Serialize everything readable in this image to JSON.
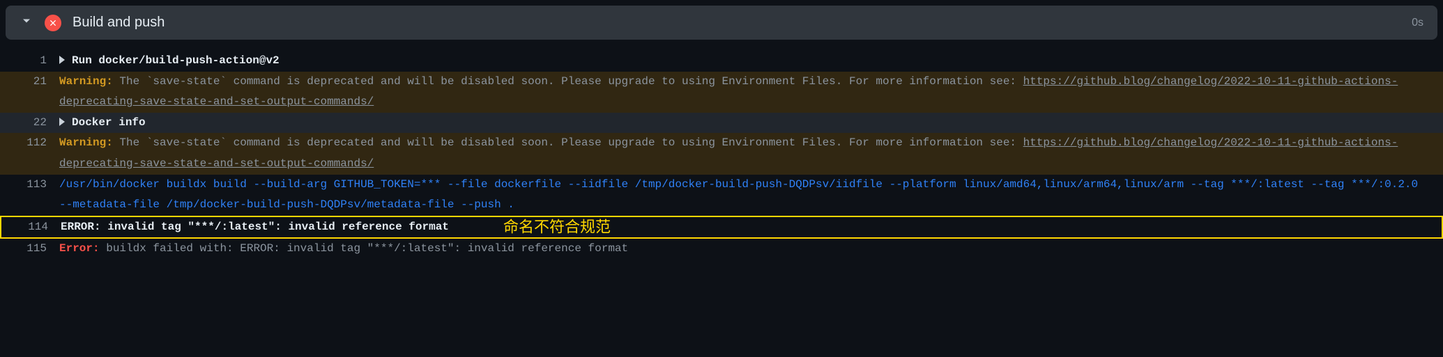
{
  "header": {
    "title": "Build and push",
    "duration": "0s"
  },
  "lines": {
    "l1": {
      "num": "1",
      "content": "Run docker/build-push-action@v2"
    },
    "l21": {
      "num": "21",
      "prefix": "Warning:",
      "text": " The `save-state` command is deprecated and will be disabled soon. Please upgrade to using Environment Files. For more information see: ",
      "link": "https://github.blog/changelog/2022-10-11-github-actions-deprecating-save-state-and-set-output-commands/"
    },
    "l22": {
      "num": "22",
      "content": "Docker info"
    },
    "l112": {
      "num": "112",
      "prefix": "Warning:",
      "text": " The `save-state` command is deprecated and will be disabled soon. Please upgrade to using Environment Files. For more information see: ",
      "link": "https://github.blog/changelog/2022-10-11-github-actions-deprecating-save-state-and-set-output-commands/"
    },
    "l113": {
      "num": "113",
      "content": "/usr/bin/docker buildx build --build-arg GITHUB_TOKEN=*** --file dockerfile --iidfile /tmp/docker-build-push-DQDPsv/iidfile --platform linux/amd64,linux/arm64,linux/arm --tag ***/:latest --tag ***/:0.2.0 --metadata-file /tmp/docker-build-push-DQDPsv/metadata-file --push ."
    },
    "l114": {
      "num": "114",
      "content": "ERROR: invalid tag \"***/:latest\": invalid reference format"
    },
    "l115": {
      "num": "115",
      "prefix": "Error:",
      "text": " buildx failed with: ERROR: invalid tag \"***/:latest\": invalid reference format"
    }
  },
  "annotation": "命名不符合规范",
  "colors": {
    "error": "#f85149",
    "warning": "#d29922",
    "info": "#2f81f7",
    "highlight": "#ffd700"
  }
}
